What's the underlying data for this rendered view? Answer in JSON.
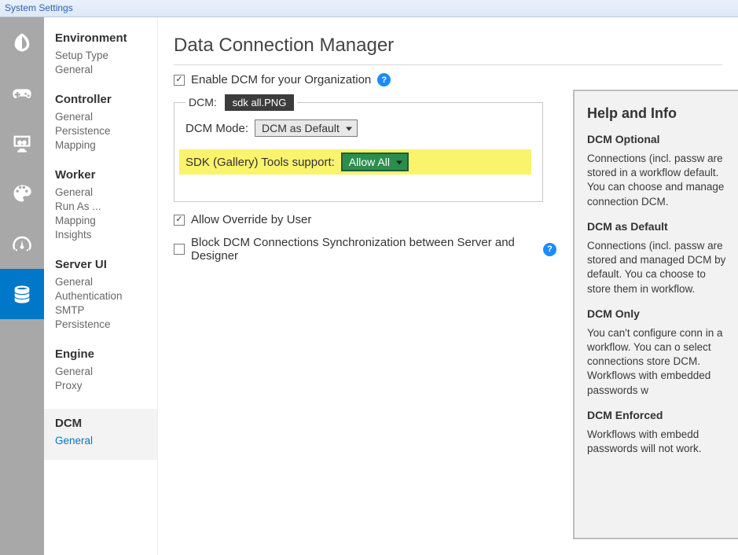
{
  "window": {
    "title": "System Settings"
  },
  "rail": {
    "items": [
      {
        "name": "environment",
        "icon": "leaf-icon"
      },
      {
        "name": "controller",
        "icon": "gamepad-icon"
      },
      {
        "name": "worker",
        "icon": "monitor-gears-icon"
      },
      {
        "name": "server-ui",
        "icon": "palette-icon"
      },
      {
        "name": "engine",
        "icon": "gauge-icon"
      },
      {
        "name": "dcm",
        "icon": "database-icon",
        "active": true
      }
    ]
  },
  "nav": {
    "sections": [
      {
        "heading": "Environment",
        "links": [
          "Setup Type",
          "General"
        ]
      },
      {
        "heading": "Controller",
        "links": [
          "General",
          "Persistence",
          "Mapping"
        ]
      },
      {
        "heading": "Worker",
        "links": [
          "General",
          "Run As ...",
          "Mapping",
          "Insights"
        ]
      },
      {
        "heading": "Server UI",
        "links": [
          "General",
          "Authentication",
          "SMTP",
          "Persistence"
        ]
      },
      {
        "heading": "Engine",
        "links": [
          "General",
          "Proxy"
        ]
      },
      {
        "heading": "DCM",
        "links": [
          "General"
        ],
        "active": true,
        "selected": 0
      }
    ]
  },
  "page": {
    "title": "Data Connection Manager",
    "enable_label": "Enable DCM for your Organization",
    "enable_checked": true,
    "fieldset_legend": "DCM:",
    "legend_tag": "sdk all.PNG",
    "mode_label": "DCM Mode:",
    "mode_value": "DCM as Default",
    "sdk_label": "SDK (Gallery) Tools support:",
    "sdk_value": "Allow All",
    "allow_override_label": "Allow Override by User",
    "allow_override_checked": true,
    "block_sync_label": "Block DCM Connections Synchronization between Server and Designer",
    "block_sync_checked": false
  },
  "help": {
    "title": "Help and Info",
    "sections": [
      {
        "heading": "DCM Optional",
        "body": "Connections (incl. passw are stored in a workflow default. You can choose and manage connection DCM."
      },
      {
        "heading": "DCM as Default",
        "body": "Connections (incl. passw are stored and managed DCM by default. You ca choose to store them in workflow."
      },
      {
        "heading": "DCM Only",
        "body": "You can't configure conn in a workflow. You can o select connections store DCM. Workflows with embedded passwords w"
      },
      {
        "heading": "DCM Enforced",
        "body": "Workflows with embedd passwords will not work."
      }
    ]
  }
}
